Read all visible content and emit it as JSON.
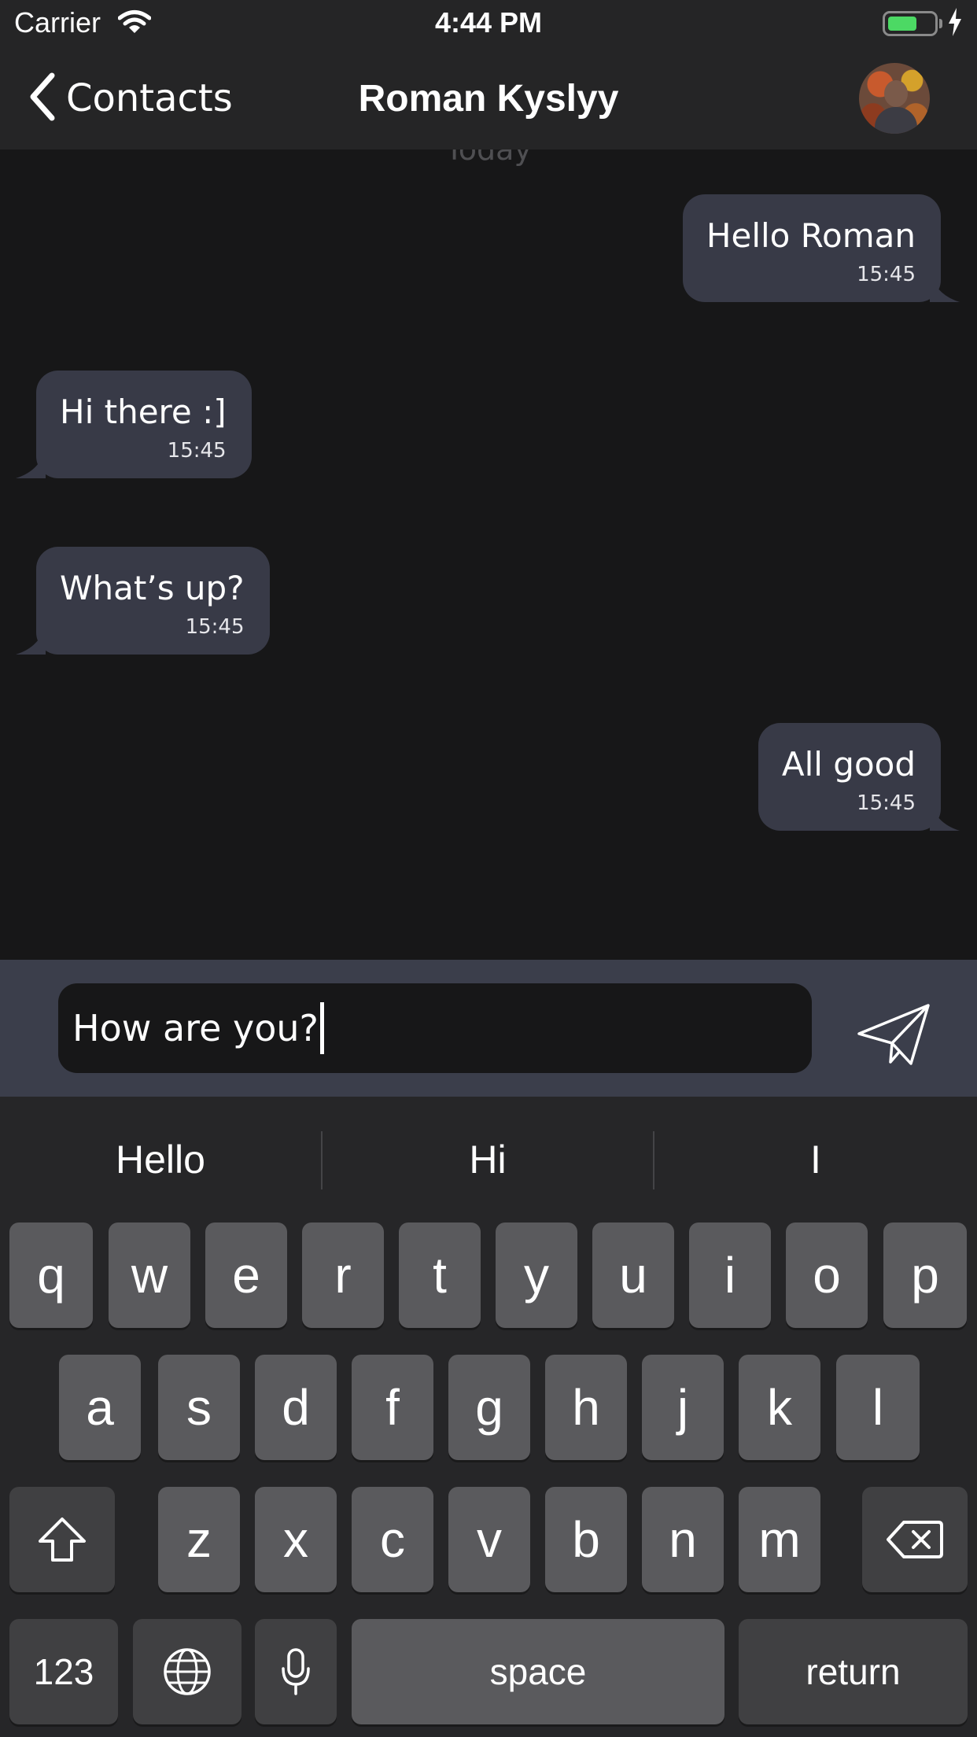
{
  "status_bar": {
    "carrier": "Carrier",
    "time": "4:44 PM",
    "battery_level": 0.65,
    "battery_color": "#4cd964"
  },
  "nav": {
    "back_label": "Contacts",
    "title": "Roman Kyslyy"
  },
  "chat": {
    "date_label": "Today",
    "bubble_color": "#383a47",
    "messages": [
      {
        "text": "Hello Roman",
        "time": "15:45",
        "side": "outgoing"
      },
      {
        "text": "Hi there :]",
        "time": "15:45",
        "side": "incoming"
      },
      {
        "text": "What’s up?",
        "time": "15:45",
        "side": "incoming"
      },
      {
        "text": "All good",
        "time": "15:45",
        "side": "outgoing"
      }
    ]
  },
  "composer": {
    "value": "How are you?",
    "send_icon": "paper-plane-icon"
  },
  "keyboard": {
    "suggestions": [
      "Hello",
      "Hi",
      "I"
    ],
    "row1": [
      "q",
      "w",
      "e",
      "r",
      "t",
      "y",
      "u",
      "i",
      "o",
      "p"
    ],
    "row2": [
      "a",
      "s",
      "d",
      "f",
      "g",
      "h",
      "j",
      "k",
      "l"
    ],
    "row3": [
      "z",
      "x",
      "c",
      "v",
      "b",
      "n",
      "m"
    ],
    "numbers_label": "123",
    "space_label": "space",
    "return_label": "return"
  }
}
